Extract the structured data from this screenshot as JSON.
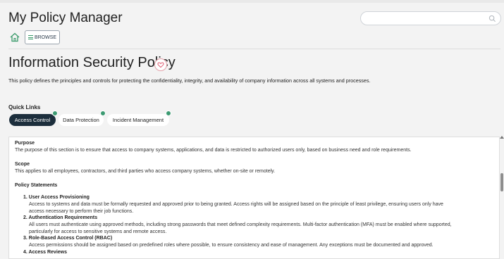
{
  "app": {
    "title": "My Policy Manager"
  },
  "search": {
    "placeholder": ""
  },
  "nav": {
    "browse_label": "BROWSE"
  },
  "policy": {
    "title": "Information Security Policy",
    "description": "This policy defines the principles and controls for protecting the confidentiality, integrity, and availability of company information across all systems and processes."
  },
  "quick_links": {
    "label": "Quick Links",
    "items": [
      {
        "label": "Access Control",
        "active": true
      },
      {
        "label": "Data Protection",
        "active": false
      },
      {
        "label": "Incident Management",
        "active": false
      }
    ]
  },
  "content": {
    "purpose": {
      "heading": "Purpose",
      "text": "The purpose of this section is to ensure that access to company systems, applications, and data is restricted to authorized users only, based on business need and role requirements."
    },
    "scope": {
      "heading": "Scope",
      "text": "This applies to all employees, contractors, and third parties who access company systems, whether on-site or remotely."
    },
    "statements": {
      "heading": "Policy Statements",
      "items": [
        {
          "title": "1. User Access Provisioning",
          "lines": [
            "Access to systems and data must be formally requested and approved prior to being granted. Access rights will be assigned based on the principle of least privilege, ensuring users only have",
            "access necessary to perform their job functions."
          ]
        },
        {
          "title": "2. Authentication Requirements",
          "lines": [
            "All users must authenticate using approved methods, including strong passwords that meet defined complexity requirements. Multi-factor authentication (MFA) must be enabled where supported,",
            "particularly for access to sensitive systems and remote access."
          ]
        },
        {
          "title": "3. Role-Based Access Control (RBAC)",
          "lines": [
            "Access permissions should be assigned based on predefined roles where possible, to ensure consistency and ease of management. Any exceptions must be documented and approved."
          ]
        },
        {
          "title": "4. Access Reviews",
          "lines": []
        }
      ]
    }
  },
  "colors": {
    "accent": "#3c9a72",
    "active_chip": "#1c2e3c",
    "favorite": "#e05c72"
  },
  "icons": {
    "home": "home-icon",
    "search": "search-icon",
    "browse": "menu-icon",
    "favorite": "heart-icon",
    "scroll_up": "chevron-up-icon"
  }
}
